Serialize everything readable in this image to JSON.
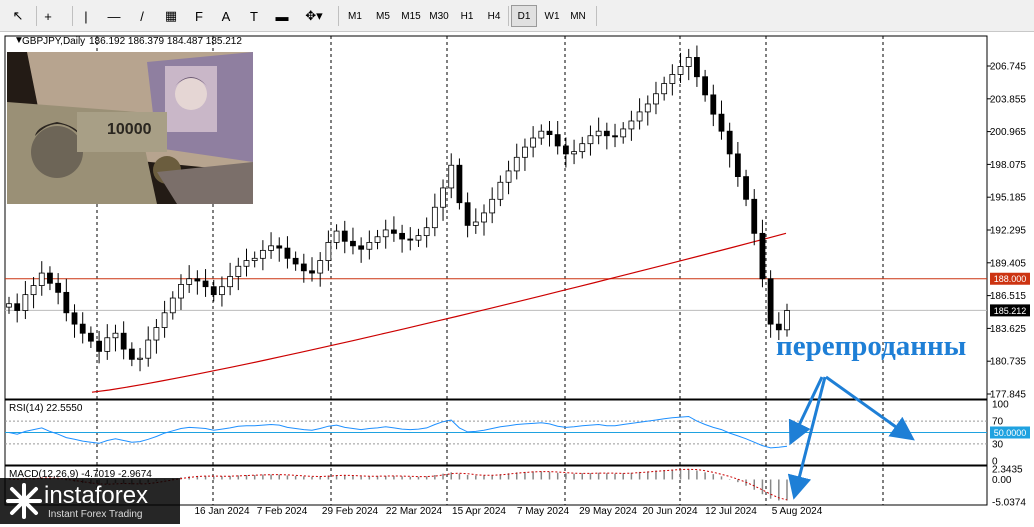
{
  "toolbar": {
    "tools": [
      {
        "name": "cursor-icon",
        "glyph": "↖"
      },
      {
        "name": "crosshair-icon",
        "glyph": "+"
      },
      {
        "name": "vertical-line-icon",
        "glyph": "|"
      },
      {
        "name": "horizontal-line-icon",
        "glyph": "—"
      },
      {
        "name": "trendline-icon",
        "glyph": "/"
      },
      {
        "name": "channel-icon",
        "glyph": "▦"
      },
      {
        "name": "fibonacci-icon",
        "glyph": "F"
      },
      {
        "name": "text-icon",
        "glyph": "A"
      },
      {
        "name": "label-icon",
        "glyph": "T"
      },
      {
        "name": "rectangle-icon",
        "glyph": "▬"
      },
      {
        "name": "shapes-icon",
        "glyph": "✥▾"
      }
    ],
    "timeframes": [
      "M1",
      "M5",
      "M15",
      "M30",
      "H1",
      "H4",
      "D1",
      "W1",
      "MN"
    ],
    "active_timeframe": "D1"
  },
  "chart_data": [
    {
      "type": "candlestick",
      "symbol_label": "GBPJPY,Daily",
      "ohlc_label": "186.192 186.379 184.487 185.212",
      "y_ticks": [
        "206.745",
        "203.855",
        "200.965",
        "198.075",
        "195.185",
        "192.295",
        "189.405",
        "186.515",
        "183.625",
        "180.735",
        "177.845"
      ],
      "ylim": [
        177.845,
        206.745
      ],
      "x_ticks": [
        "16 Jan 2024",
        "7 Feb 2024",
        "29 Feb 2024",
        "22 Mar 2024",
        "15 Apr 2024",
        "7 May 2024",
        "29 May 2024",
        "20 Jun 2024",
        "12 Jul 2024",
        "5 Aug 2024"
      ],
      "current_price": "185.212",
      "level_line": "188.000",
      "moving_average": {
        "color": "#cc0000",
        "start": 178.0,
        "end": 192.0
      },
      "path": [
        185.8,
        185.2,
        186.6,
        187.4,
        188.5,
        187.6,
        186.8,
        185.0,
        184.0,
        183.2,
        182.5,
        181.6,
        182.8,
        183.2,
        181.8,
        180.9,
        181.0,
        182.6,
        183.7,
        185.0,
        186.3,
        187.5,
        188.0,
        187.8,
        187.3,
        186.6,
        187.3,
        188.2,
        189.1,
        189.6,
        189.8,
        190.5,
        190.9,
        190.7,
        189.8,
        189.3,
        188.7,
        188.5,
        189.6,
        191.2,
        192.2,
        191.3,
        190.9,
        190.6,
        191.2,
        191.7,
        192.3,
        192.0,
        191.5,
        191.4,
        191.8,
        192.5,
        194.3,
        196.0,
        198.0,
        194.7,
        192.7,
        193.0,
        193.8,
        195.0,
        196.5,
        197.5,
        198.7,
        199.6,
        200.4,
        201.0,
        200.7,
        199.7,
        199.0,
        199.2,
        199.9,
        200.6,
        201.0,
        200.6,
        200.5,
        201.2,
        201.9,
        202.7,
        203.4,
        204.3,
        205.2,
        206.0,
        206.7,
        207.5,
        205.8,
        204.2,
        202.5,
        201.0,
        199.0,
        197.0,
        195.0,
        192.0,
        188.0,
        184.0,
        183.5,
        185.2
      ]
    },
    {
      "type": "line",
      "label": "RSI(14) 22.5550",
      "y_ticks": [
        "100",
        "70",
        "50.0000",
        "30",
        "0"
      ],
      "ylim": [
        0,
        100
      ],
      "levels": [
        70,
        30
      ],
      "highlight_level": "50.0000",
      "values": [
        50,
        47,
        52,
        55,
        58,
        52,
        47,
        41,
        38,
        35,
        33,
        31,
        36,
        39,
        36,
        33,
        34,
        38,
        43,
        49,
        53,
        57,
        59,
        58,
        57,
        54,
        56,
        58,
        61,
        62,
        62,
        63,
        64,
        63,
        59,
        57,
        55,
        54,
        57,
        61,
        63,
        59,
        57,
        55,
        57,
        58,
        60,
        58,
        56,
        55,
        56,
        58,
        64,
        69,
        72,
        58,
        51,
        52,
        54,
        57,
        60,
        62,
        64,
        65,
        66,
        67,
        65,
        61,
        59,
        60,
        62,
        63,
        64,
        62,
        62,
        64,
        66,
        68,
        70,
        72,
        74,
        76,
        77,
        78,
        70,
        64,
        59,
        55,
        49,
        44,
        39,
        33,
        27,
        23,
        24,
        26
      ]
    },
    {
      "type": "bar",
      "label": "MACD(12,26,9) -4.7019 -2.9674",
      "y_ticks": [
        "2.3435",
        "0.00",
        "-5.0374"
      ],
      "ylim": [
        -5.0374,
        2.3435
      ],
      "values": [
        0.1,
        0.0,
        0.2,
        0.3,
        0.4,
        0.3,
        0.1,
        -0.2,
        -0.5,
        -0.8,
        -1.0,
        -1.2,
        -1.0,
        -0.8,
        -0.9,
        -1.1,
        -1.0,
        -0.7,
        -0.4,
        -0.1,
        0.2,
        0.5,
        0.7,
        0.8,
        0.8,
        0.7,
        0.7,
        0.8,
        0.9,
        1.0,
        1.0,
        1.1,
        1.1,
        1.1,
        0.9,
        0.8,
        0.7,
        0.6,
        0.7,
        0.9,
        1.0,
        0.9,
        0.8,
        0.7,
        0.7,
        0.8,
        0.8,
        0.8,
        0.7,
        0.6,
        0.6,
        0.7,
        1.0,
        1.3,
        1.6,
        1.3,
        1.0,
        0.9,
        0.9,
        1.0,
        1.2,
        1.4,
        1.6,
        1.7,
        1.8,
        1.8,
        1.7,
        1.5,
        1.4,
        1.3,
        1.4,
        1.4,
        1.5,
        1.4,
        1.3,
        1.4,
        1.5,
        1.7,
        1.8,
        2.0,
        2.1,
        2.2,
        2.3,
        2.3,
        2.0,
        1.6,
        1.2,
        0.7,
        0.1,
        -0.6,
        -1.4,
        -2.3,
        -3.3,
        -4.3,
        -4.7,
        -4.7
      ]
    }
  ],
  "annotation": {
    "text": "перепроданны",
    "color": "#1e7fd6"
  },
  "logo": {
    "brand": "instaforex",
    "tagline": "Instant Forex Trading"
  }
}
